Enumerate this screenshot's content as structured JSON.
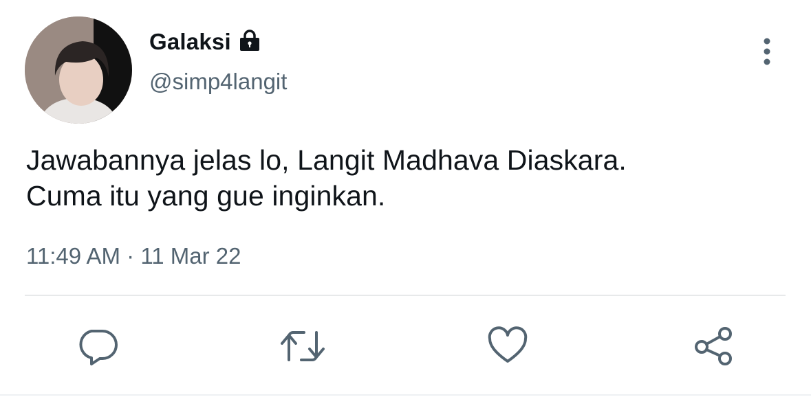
{
  "tweet": {
    "author": {
      "display_name": "Galaksi",
      "handle": "@simp4langit",
      "protected": true
    },
    "text_lines": [
      "Jawabannya jelas lo, Langit Madhava Diaskara.",
      "Cuma itu yang gue inginkan."
    ],
    "time": "11:49 AM",
    "separator": "·",
    "date": "11 Mar 22"
  },
  "icons": {
    "lock": "lock-icon",
    "more": "more-vertical-icon",
    "reply": "reply-icon",
    "retweet": "retweet-icon",
    "like": "heart-icon",
    "share": "share-icon"
  },
  "colors": {
    "text_primary": "#0f1419",
    "text_secondary": "#536471",
    "icon": "#536471",
    "divider": "#e7e9ea",
    "background": "#ffffff"
  }
}
